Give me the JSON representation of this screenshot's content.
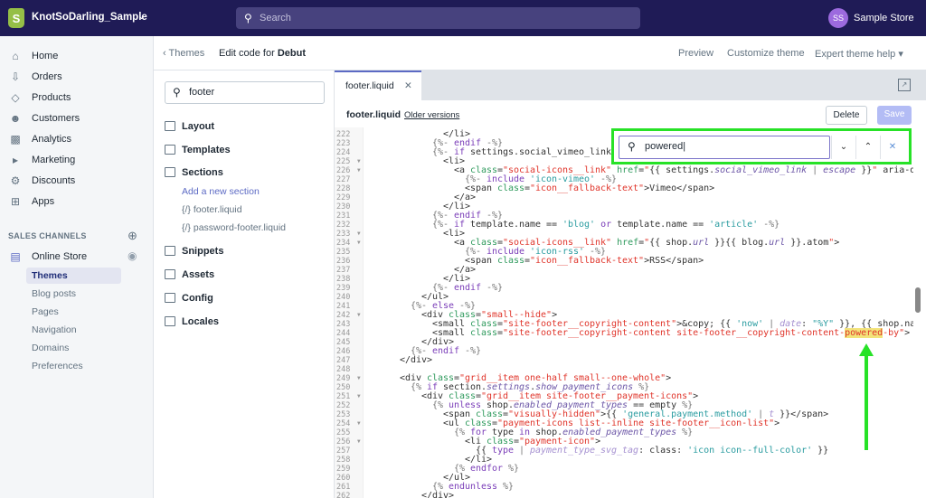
{
  "topbar": {
    "store_name": "KnotSoDarling_Sample",
    "search_placeholder": "Search",
    "avatar_initials": "SS",
    "account_name": "Sample Store"
  },
  "sidebar": {
    "items": [
      {
        "label": "Home",
        "icon": "home-icon"
      },
      {
        "label": "Orders",
        "icon": "orders-icon"
      },
      {
        "label": "Products",
        "icon": "tag-icon"
      },
      {
        "label": "Customers",
        "icon": "person-icon"
      },
      {
        "label": "Analytics",
        "icon": "bar-chart-icon"
      },
      {
        "label": "Marketing",
        "icon": "megaphone-icon"
      },
      {
        "label": "Discounts",
        "icon": "discount-icon"
      },
      {
        "label": "Apps",
        "icon": "apps-icon"
      }
    ],
    "sales_channels_label": "SALES CHANNELS",
    "online_store": "Online Store",
    "sub_items": [
      "Themes",
      "Blog posts",
      "Pages",
      "Navigation",
      "Domains",
      "Preferences"
    ],
    "active_sub": "Themes"
  },
  "subheader": {
    "back": "Themes",
    "title_prefix": "Edit code for",
    "title_theme": "Debut",
    "preview": "Preview",
    "customize": "Customize theme",
    "expert_help": "Expert theme help"
  },
  "tree": {
    "search_value": "footer",
    "folders": [
      "Layout",
      "Templates",
      "Sections",
      "Snippets",
      "Assets",
      "Config",
      "Locales"
    ],
    "add_section": "Add a new section",
    "section_files": [
      "footer.liquid",
      "password-footer.liquid"
    ],
    "file_prefix": "{/}"
  },
  "editor": {
    "tab": "footer.liquid",
    "file_name": "footer.liquid",
    "older_versions": "Older versions",
    "delete": "Delete",
    "save": "Save",
    "find": {
      "value": "powered"
    },
    "accent_color": "#5c6ac4",
    "annotation_color": "#27e227",
    "lines": [
      {
        "n": 222,
        "i": 13,
        "c": [
          [
            "t",
            "</li>"
          ]
        ]
      },
      {
        "n": 223,
        "i": 11,
        "c": [
          [
            "d",
            "{%- "
          ],
          [
            "k",
            "endif"
          ],
          [
            "d",
            " -%}"
          ]
        ]
      },
      {
        "n": 224,
        "i": 11,
        "c": [
          [
            "d",
            "{%- "
          ],
          [
            "k",
            "if "
          ],
          [
            "t",
            "settings.social_vimeo_link"
          ]
        ]
      },
      {
        "n": 225,
        "i": 13,
        "f": 1,
        "c": [
          [
            "t",
            "<li>"
          ]
        ]
      },
      {
        "n": 226,
        "i": 15,
        "f": 1,
        "c": [
          [
            "t",
            "<a "
          ],
          [
            "a",
            "class"
          ],
          [
            "t",
            "="
          ],
          [
            "s",
            "\"social-icons__link\""
          ],
          [
            "t",
            " "
          ],
          [
            "a",
            "href"
          ],
          [
            "t",
            "="
          ],
          [
            "s",
            "\""
          ],
          [
            "t",
            "{{ settings."
          ],
          [
            "v",
            "social_vimeo_link"
          ],
          [
            "d",
            " | "
          ],
          [
            "v",
            "escape"
          ],
          [
            "t",
            " }}"
          ],
          [
            "s",
            "\""
          ],
          [
            "t",
            " aria-describedby"
          ]
        ]
      },
      {
        "n": 227,
        "i": 17,
        "c": [
          [
            "d",
            "{%- "
          ],
          [
            "k",
            "include "
          ],
          [
            "q",
            "'icon-vimeo'"
          ],
          [
            "d",
            " -%}"
          ]
        ]
      },
      {
        "n": 228,
        "i": 17,
        "c": [
          [
            "t",
            "<span "
          ],
          [
            "a",
            "class"
          ],
          [
            "t",
            "="
          ],
          [
            "s",
            "\"icon__fallback-text\""
          ],
          [
            "t",
            ">Vimeo</span>"
          ]
        ]
      },
      {
        "n": 229,
        "i": 15,
        "c": [
          [
            "t",
            "</a>"
          ]
        ]
      },
      {
        "n": 230,
        "i": 13,
        "c": [
          [
            "t",
            "</li>"
          ]
        ]
      },
      {
        "n": 231,
        "i": 11,
        "c": [
          [
            "d",
            "{%- "
          ],
          [
            "k",
            "endif"
          ],
          [
            "d",
            " -%}"
          ]
        ]
      },
      {
        "n": 232,
        "i": 11,
        "c": [
          [
            "d",
            "{%- "
          ],
          [
            "k",
            "if "
          ],
          [
            "t",
            "template.name == "
          ],
          [
            "q",
            "'blog'"
          ],
          [
            "k",
            " or "
          ],
          [
            "t",
            "template.name == "
          ],
          [
            "q",
            "'article'"
          ],
          [
            "d",
            " -%}"
          ]
        ]
      },
      {
        "n": 233,
        "i": 13,
        "f": 1,
        "c": [
          [
            "t",
            "<li>"
          ]
        ]
      },
      {
        "n": 234,
        "i": 15,
        "f": 1,
        "c": [
          [
            "t",
            "<a "
          ],
          [
            "a",
            "class"
          ],
          [
            "t",
            "="
          ],
          [
            "s",
            "\"social-icons__link\""
          ],
          [
            "t",
            " "
          ],
          [
            "a",
            "href"
          ],
          [
            "t",
            "="
          ],
          [
            "s",
            "\""
          ],
          [
            "t",
            "{{ shop."
          ],
          [
            "v",
            "url"
          ],
          [
            "t",
            " }}{{ blog."
          ],
          [
            "v",
            "url"
          ],
          [
            "t",
            " }}.atom"
          ],
          [
            "s",
            "\""
          ],
          [
            "t",
            ">"
          ]
        ]
      },
      {
        "n": 235,
        "i": 17,
        "c": [
          [
            "d",
            "{%- "
          ],
          [
            "k",
            "include "
          ],
          [
            "q",
            "'icon-rss'"
          ],
          [
            "d",
            " -%}"
          ]
        ]
      },
      {
        "n": 236,
        "i": 17,
        "c": [
          [
            "t",
            "<span "
          ],
          [
            "a",
            "class"
          ],
          [
            "t",
            "="
          ],
          [
            "s",
            "\"icon__fallback-text\""
          ],
          [
            "t",
            ">RSS</span>"
          ]
        ]
      },
      {
        "n": 237,
        "i": 15,
        "c": [
          [
            "t",
            "</a>"
          ]
        ]
      },
      {
        "n": 238,
        "i": 13,
        "c": [
          [
            "t",
            "</li>"
          ]
        ]
      },
      {
        "n": 239,
        "i": 11,
        "c": [
          [
            "d",
            "{%- "
          ],
          [
            "k",
            "endif"
          ],
          [
            "d",
            " -%}"
          ]
        ]
      },
      {
        "n": 240,
        "i": 9,
        "c": [
          [
            "t",
            "</ul>"
          ]
        ]
      },
      {
        "n": 241,
        "i": 7,
        "c": [
          [
            "d",
            "{%- "
          ],
          [
            "k",
            "else"
          ],
          [
            "d",
            " -%}"
          ]
        ]
      },
      {
        "n": 242,
        "i": 9,
        "f": 1,
        "c": [
          [
            "t",
            "<div "
          ],
          [
            "a",
            "class"
          ],
          [
            "t",
            "="
          ],
          [
            "s",
            "\"small--hide\""
          ],
          [
            "t",
            ">"
          ]
        ]
      },
      {
        "n": 243,
        "i": 11,
        "c": [
          [
            "t",
            "<small "
          ],
          [
            "a",
            "class"
          ],
          [
            "t",
            "="
          ],
          [
            "s",
            "\"site-footer__copyright-content\""
          ],
          [
            "t",
            ">&copy; {{ "
          ],
          [
            "q",
            "'now'"
          ],
          [
            "d",
            " | "
          ],
          [
            "f",
            "date"
          ],
          [
            "t",
            ": "
          ],
          [
            "q",
            "\"%Y\""
          ],
          [
            "t",
            " }}, {{ "
          ],
          [
            "t",
            "shop.name"
          ]
        ]
      },
      {
        "n": 244,
        "i": 11,
        "c": [
          [
            "t",
            "<small "
          ],
          [
            "a",
            "class"
          ],
          [
            "t",
            "="
          ],
          [
            "s",
            "\"site-footer__copyright-content site-footer__copyright-content-"
          ],
          [
            "h",
            "powered"
          ],
          [
            "s",
            "-by\""
          ],
          [
            "t",
            ">"
          ]
        ]
      },
      {
        "n": 245,
        "i": 9,
        "c": [
          [
            "t",
            "</div>"
          ]
        ]
      },
      {
        "n": 246,
        "i": 7,
        "c": [
          [
            "d",
            "{%- "
          ],
          [
            "k",
            "endif"
          ],
          [
            "d",
            " -%}"
          ]
        ]
      },
      {
        "n": 247,
        "i": 5,
        "c": [
          [
            "t",
            "</div>"
          ]
        ]
      },
      {
        "n": 248,
        "i": 0,
        "c": []
      },
      {
        "n": 249,
        "i": 5,
        "f": 1,
        "c": [
          [
            "t",
            "<div "
          ],
          [
            "a",
            "class"
          ],
          [
            "t",
            "="
          ],
          [
            "s",
            "\"grid__item one-half small--one-whole\""
          ],
          [
            "t",
            ">"
          ]
        ]
      },
      {
        "n": 250,
        "i": 7,
        "c": [
          [
            "d",
            "{% "
          ],
          [
            "k",
            "if "
          ],
          [
            "t",
            "section."
          ],
          [
            "v",
            "settings"
          ],
          [
            "t",
            "."
          ],
          [
            "v",
            "show_payment_icons"
          ],
          [
            "d",
            " %}"
          ]
        ]
      },
      {
        "n": 251,
        "i": 9,
        "f": 1,
        "c": [
          [
            "t",
            "<div "
          ],
          [
            "a",
            "class"
          ],
          [
            "t",
            "="
          ],
          [
            "s",
            "\"grid__item site-footer__payment-icons\""
          ],
          [
            "t",
            ">"
          ]
        ]
      },
      {
        "n": 252,
        "i": 11,
        "c": [
          [
            "d",
            "{% "
          ],
          [
            "k",
            "unless "
          ],
          [
            "t",
            "shop."
          ],
          [
            "v",
            "enabled_payment_types"
          ],
          [
            "t",
            " == empty"
          ],
          [
            "d",
            " %}"
          ]
        ]
      },
      {
        "n": 253,
        "i": 13,
        "c": [
          [
            "t",
            "<span "
          ],
          [
            "a",
            "class"
          ],
          [
            "t",
            "="
          ],
          [
            "s",
            "\"visually-hidden\""
          ],
          [
            "t",
            ">{{ "
          ],
          [
            "q",
            "'general.payment.method'"
          ],
          [
            "d",
            " | "
          ],
          [
            "f",
            "t"
          ],
          [
            "t",
            " }}</span>"
          ]
        ]
      },
      {
        "n": 254,
        "i": 13,
        "f": 1,
        "c": [
          [
            "t",
            "<ul "
          ],
          [
            "a",
            "class"
          ],
          [
            "t",
            "="
          ],
          [
            "s",
            "\"payment-icons list--inline site-footer__icon-list\""
          ],
          [
            "t",
            ">"
          ]
        ]
      },
      {
        "n": 255,
        "i": 15,
        "c": [
          [
            "d",
            "{% "
          ],
          [
            "k",
            "for "
          ],
          [
            "t",
            "type "
          ],
          [
            "k",
            "in "
          ],
          [
            "t",
            "shop."
          ],
          [
            "v",
            "enabled_payment_types"
          ],
          [
            "d",
            " %}"
          ]
        ]
      },
      {
        "n": 256,
        "i": 17,
        "f": 1,
        "c": [
          [
            "t",
            "<li "
          ],
          [
            "a",
            "class"
          ],
          [
            "t",
            "="
          ],
          [
            "s",
            "\"payment-icon\""
          ],
          [
            "t",
            ">"
          ]
        ]
      },
      {
        "n": 257,
        "i": 19,
        "c": [
          [
            "t",
            "{{ "
          ],
          [
            "k",
            "type"
          ],
          [
            "d",
            " | "
          ],
          [
            "f",
            "payment_type_svg_tag"
          ],
          [
            "t",
            ": class: "
          ],
          [
            "q",
            "'icon icon--full-color'"
          ],
          [
            "t",
            " }}"
          ]
        ]
      },
      {
        "n": 258,
        "i": 17,
        "c": [
          [
            "t",
            "</li>"
          ]
        ]
      },
      {
        "n": 259,
        "i": 15,
        "c": [
          [
            "d",
            "{% "
          ],
          [
            "k",
            "endfor"
          ],
          [
            "d",
            " %}"
          ]
        ]
      },
      {
        "n": 260,
        "i": 13,
        "c": [
          [
            "t",
            "</ul>"
          ]
        ]
      },
      {
        "n": 261,
        "i": 11,
        "c": [
          [
            "d",
            "{% "
          ],
          [
            "k",
            "endunless"
          ],
          [
            "d",
            " %}"
          ]
        ]
      },
      {
        "n": 262,
        "i": 9,
        "c": [
          [
            "t",
            "</div>"
          ]
        ]
      }
    ]
  }
}
